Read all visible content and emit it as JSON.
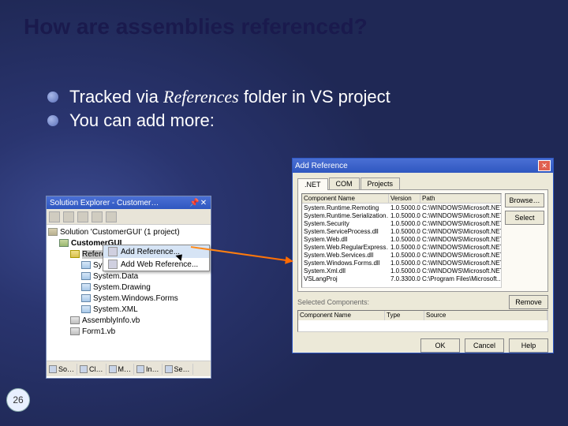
{
  "slide": {
    "title": "How are assemblies referenced?",
    "page_number": "26",
    "bullets": [
      {
        "pre": "Tracked via ",
        "em": "References",
        "post": " folder in VS project"
      },
      {
        "pre": "You can add more:",
        "em": "",
        "post": ""
      }
    ]
  },
  "solution_explorer": {
    "title": "Solution Explorer - Customer…",
    "pin": "📌",
    "close": "✕",
    "root": "Solution 'CustomerGUI' (1 project)",
    "project": "CustomerGUI",
    "references_label": "References",
    "refs": [
      "System",
      "System.Data",
      "System.Drawing",
      "System.Windows.Forms",
      "System.XML"
    ],
    "files": [
      "AssemblyInfo.vb",
      "Form1.vb"
    ],
    "tabs": [
      "So…",
      "Cl…",
      "M…",
      "In…",
      "Se…"
    ]
  },
  "context_menu": {
    "items": [
      "Add Reference...",
      "Add Web Reference..."
    ]
  },
  "dialog": {
    "title": "Add Reference",
    "close": "✕",
    "tabs": [
      ".NET",
      "COM",
      "Projects"
    ],
    "columns": {
      "name": "Component Name",
      "version": "Version",
      "path": "Path"
    },
    "side_buttons": [
      "Browse…",
      "Select"
    ],
    "rows": [
      {
        "name": "System.Runtime.Remoting",
        "ver": "1.0.5000.0",
        "path": "C:\\WINDOWS\\Microsoft.NET"
      },
      {
        "name": "System.Runtime.Serialization…",
        "ver": "1.0.5000.0",
        "path": "C:\\WINDOWS\\Microsoft.NET"
      },
      {
        "name": "System.Security",
        "ver": "1.0.5000.0",
        "path": "C:\\WINDOWS\\Microsoft.NET"
      },
      {
        "name": "System.ServiceProcess.dll",
        "ver": "1.0.5000.0",
        "path": "C:\\WINDOWS\\Microsoft.NET"
      },
      {
        "name": "System.Web.dll",
        "ver": "1.0.5000.0",
        "path": "C:\\WINDOWS\\Microsoft.NET"
      },
      {
        "name": "System.Web.RegularExpress…",
        "ver": "1.0.5000.0",
        "path": "C:\\WINDOWS\\Microsoft.NET"
      },
      {
        "name": "System.Web.Services.dll",
        "ver": "1.0.5000.0",
        "path": "C:\\WINDOWS\\Microsoft.NET"
      },
      {
        "name": "System.Windows.Forms.dll",
        "ver": "1.0.5000.0",
        "path": "C:\\WINDOWS\\Microsoft.NET"
      },
      {
        "name": "System.Xml.dll",
        "ver": "1.0.5000.0",
        "path": "C:\\WINDOWS\\Microsoft.NET"
      },
      {
        "name": "VSLangProj",
        "ver": "7.0.3300.0",
        "path": "C:\\Program Files\\Microsoft…"
      }
    ],
    "selected_label": "Selected Components:",
    "sel_columns": {
      "name": "Component Name",
      "type": "Type",
      "source": "Source"
    },
    "remove": "Remove",
    "bottom": [
      "OK",
      "Cancel",
      "Help"
    ]
  }
}
